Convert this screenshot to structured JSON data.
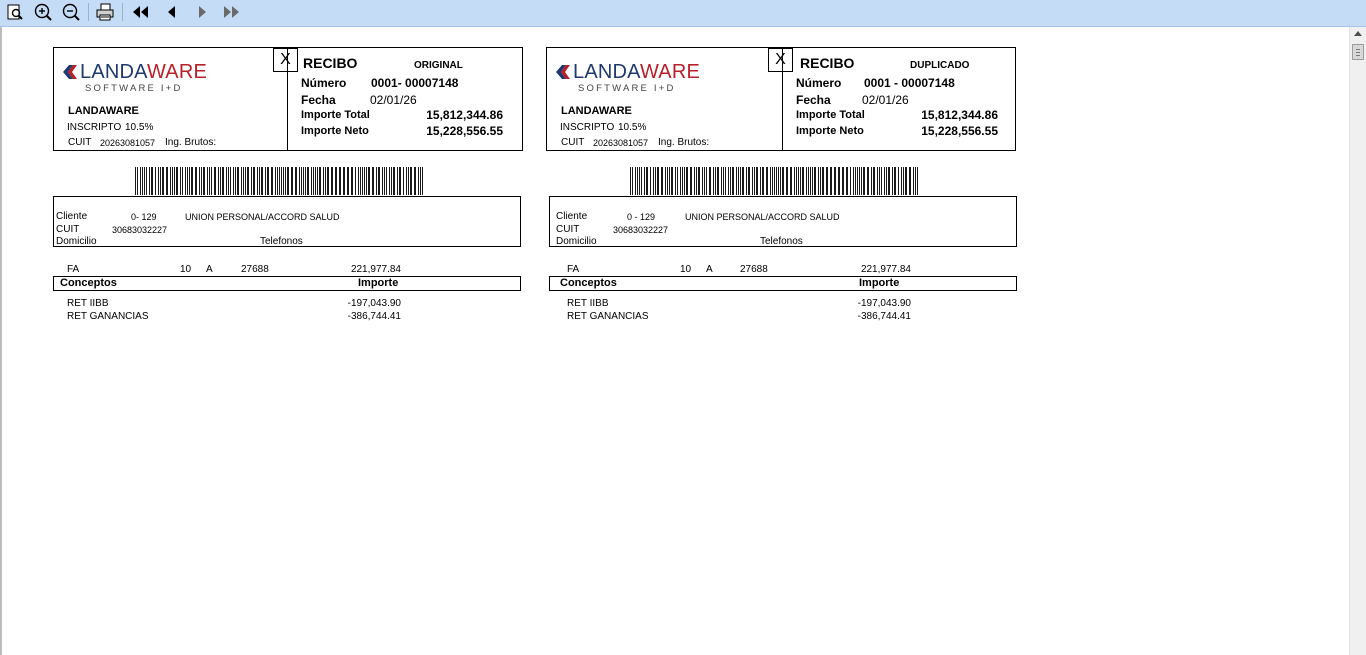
{
  "toolbar": {
    "buttons": [
      {
        "name": "page-view-icon"
      },
      {
        "name": "zoom-in-icon"
      },
      {
        "name": "zoom-out-icon"
      },
      {
        "name": "print-icon"
      },
      {
        "name": "first-page-icon"
      },
      {
        "name": "previous-page-icon"
      },
      {
        "name": "next-page-icon"
      },
      {
        "name": "last-page-icon"
      }
    ]
  },
  "receipts": [
    {
      "copy": "ORIGINAL",
      "x_mark": "X",
      "title": "RECIBO",
      "logo_brand_dark": "LANDA",
      "logo_brand_red": "WARE",
      "logo_sub": "SOFTWARE I+D",
      "company": "LANDAWARE",
      "tax_label": "INSCRIPTO",
      "tax_rate": "10.5%",
      "cuit_label": "CUIT",
      "cuit": "20263081057",
      "iibb_label": "Ing. Brutos:",
      "numero_label": "Número",
      "numero": "0001-  00007148",
      "fecha_label": "Fecha",
      "fecha": "02/01/26",
      "total_label": "Importe Total",
      "total": "15,812,344.86",
      "neto_label": "Importe Neto",
      "neto": "15,228,556.55",
      "cliente_label": "Cliente",
      "cliente_code": "0- 129",
      "cliente_name": "UNION PERSONAL/ACCORD SALUD",
      "cliente_cuit_label": "CUIT",
      "cliente_cuit": "30683032227",
      "domicilio_label": "Domicilio",
      "telefonos_label": "Telefonos",
      "doc_type": "FA",
      "doc_pv": "10",
      "doc_letter": "A",
      "doc_number": "27688",
      "doc_amount": "221,977.84",
      "conceptos_label": "Conceptos",
      "importe_label": "Importe",
      "items": [
        {
          "concept": "RET IIBB",
          "amount": "-197,043.90"
        },
        {
          "concept": "RET GANANCIAS",
          "amount": "-386,744.41"
        }
      ]
    },
    {
      "copy": "DUPLICADO",
      "x_mark": "X",
      "title": "RECIBO",
      "logo_brand_dark": "LANDA",
      "logo_brand_red": "WARE",
      "logo_sub": "SOFTWARE I+D",
      "company": "LANDAWARE",
      "tax_label": "INSCRIPTO",
      "tax_rate": "10.5%",
      "cuit_label": "CUIT",
      "cuit": "20263081057",
      "iibb_label": "Ing. Brutos:",
      "numero_label": "Número",
      "numero": "0001 - 00007148",
      "fecha_label": "Fecha",
      "fecha": "02/01/26",
      "total_label": "Importe Total",
      "total": "15,812,344.86",
      "neto_label": "Importe Neto",
      "neto": "15,228,556.55",
      "cliente_label": "Cliente",
      "cliente_code": "0 - 129",
      "cliente_name": "UNION PERSONAL/ACCORD SALUD",
      "cliente_cuit_label": "CUIT",
      "cliente_cuit": "30683032227",
      "domicilio_label": "Domicilio",
      "telefonos_label": "Telefonos",
      "doc_type": "FA",
      "doc_pv": "10",
      "doc_letter": "A",
      "doc_number": "27688",
      "doc_amount": "221,977.84",
      "conceptos_label": "Conceptos",
      "importe_label": "Importe",
      "items": [
        {
          "concept": "RET IIBB",
          "amount": "-197,043.90"
        },
        {
          "concept": "RET GANANCIAS",
          "amount": "-386,744.41"
        }
      ]
    }
  ],
  "colors": {
    "toolbar_bg": "#c4dcf6",
    "logo_red": "#b8202a",
    "logo_dark": "#1e3a6e"
  }
}
